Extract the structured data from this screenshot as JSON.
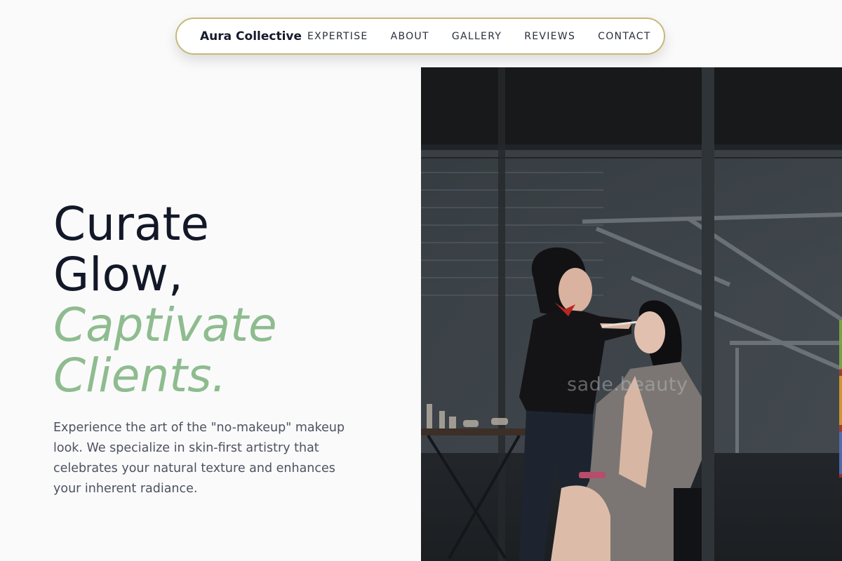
{
  "nav": {
    "brand": "Aura Collective",
    "links": [
      "EXPERTISE",
      "ABOUT",
      "GALLERY",
      "REVIEWS",
      "CONTACT"
    ]
  },
  "hero": {
    "headline_line1": "Curate",
    "headline_line2": "Glow,",
    "headline_accent_line1": "Captivate",
    "headline_accent_line2": "Clients.",
    "description": "Experience the art of the \"no-makeup\" makeup look. We specialize in skin-first artistry that celebrates your natural texture and enhances your inherent radiance."
  },
  "photo": {
    "watermark": "sade.beauty"
  },
  "colors": {
    "accent_green": "#8ebc8e",
    "nav_border_gold": "#c5b978",
    "heading_dark": "#131828",
    "body_text": "#4d5260"
  }
}
